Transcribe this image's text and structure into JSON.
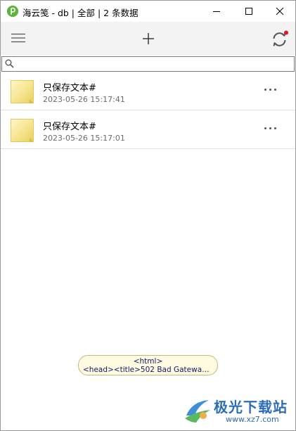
{
  "window": {
    "title": "海云笺 - db | 全部 | 2 条数据"
  },
  "icons": {
    "app": "app-logo-icon",
    "minimize": "minimize-icon",
    "maximize": "maximize-icon",
    "close": "close-icon",
    "menu": "hamburger-menu-icon",
    "add": "plus-icon",
    "sync": "sync-icon",
    "search": "search-icon",
    "more": "more-options-icon"
  },
  "colors": {
    "accent_dot": "#e81123",
    "toolbar_bg": "#f3f3f3",
    "note_yellow": "#f6e48d"
  },
  "search": {
    "value": "",
    "placeholder": ""
  },
  "notes": [
    {
      "title": "只保存文本#",
      "date": "2023-05-26 15:17:41"
    },
    {
      "title": "只保存文本#",
      "date": "2023-05-26 15:17:01"
    }
  ],
  "tooltip": {
    "line1": "<html>",
    "line2": "<head><title>502 Bad Gateway<..."
  },
  "watermark": {
    "name": "极光下载站",
    "url": "www.xz7.com"
  }
}
